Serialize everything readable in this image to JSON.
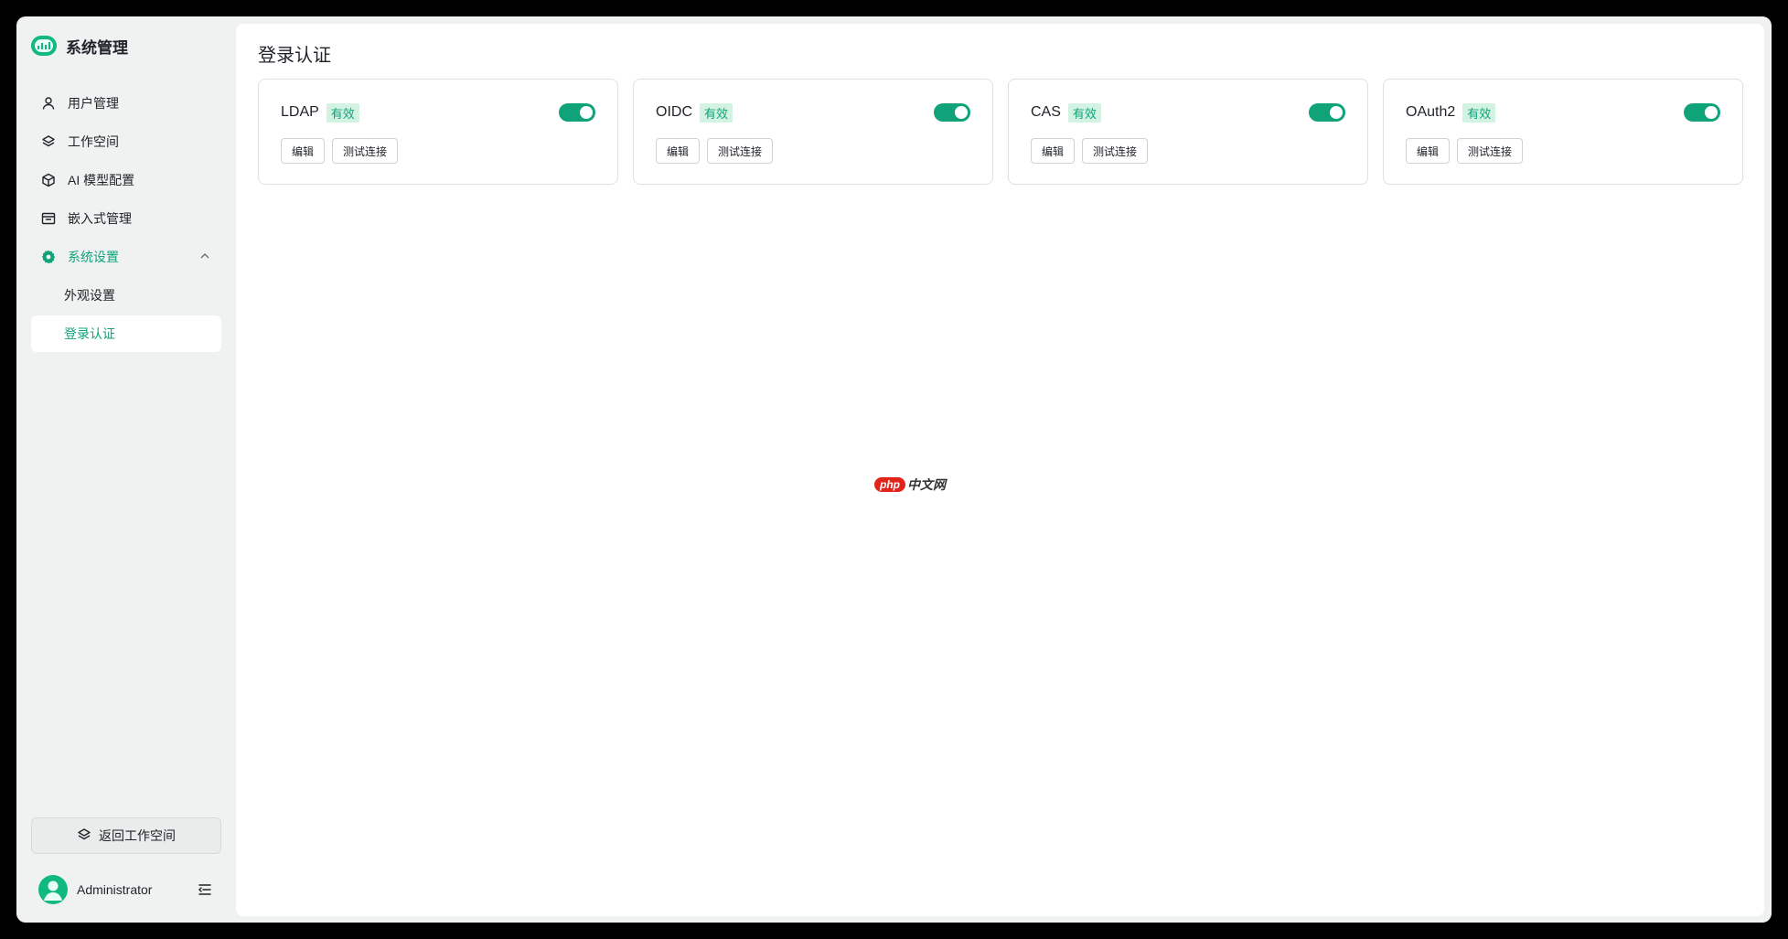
{
  "app": {
    "title": "系统管理"
  },
  "sidebar": {
    "items": [
      {
        "label": "用户管理",
        "icon": "user-icon"
      },
      {
        "label": "工作空间",
        "icon": "layers-icon"
      },
      {
        "label": "AI 模型配置",
        "icon": "cube-icon"
      },
      {
        "label": "嵌入式管理",
        "icon": "window-icon"
      },
      {
        "label": "系统设置",
        "icon": "gear-icon",
        "expanded": true,
        "children": [
          {
            "label": "外观设置"
          },
          {
            "label": "登录认证",
            "selected": true
          }
        ]
      }
    ],
    "back_button": "返回工作空间",
    "user_name": "Administrator"
  },
  "main": {
    "title": "登录认证",
    "cards": [
      {
        "name": "LDAP",
        "status": "有效",
        "enabled": true,
        "edit": "编辑",
        "test": "测试连接"
      },
      {
        "name": "OIDC",
        "status": "有效",
        "enabled": true,
        "edit": "编辑",
        "test": "测试连接"
      },
      {
        "name": "CAS",
        "status": "有效",
        "enabled": true,
        "edit": "编辑",
        "test": "测试连接"
      },
      {
        "name": "OAuth2",
        "status": "有效",
        "enabled": true,
        "edit": "编辑",
        "test": "测试连接"
      }
    ]
  },
  "watermark": {
    "brand": "php",
    "suffix": "中文网"
  },
  "colors": {
    "accent": "#10a37a",
    "badge_bg": "#d3f3e2",
    "sidebar_bg": "#f0f2f1"
  }
}
